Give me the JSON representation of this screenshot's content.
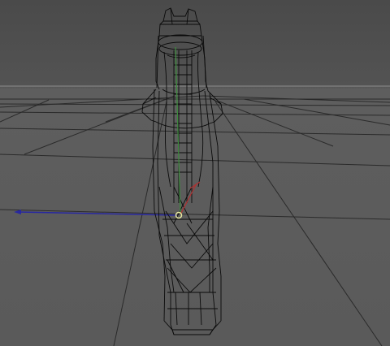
{
  "viewport": {
    "background_color": "#585858",
    "grid_color": "#2a2a2a",
    "horizon_color": "#8c8c8c",
    "wire_color": "#0a0a0a",
    "axis_x_color": "#b03030",
    "axis_y_color": "#3c8c3c",
    "axis_z_color": "#2828a0",
    "pivot_color": "#e8e8a0"
  },
  "object": {
    "type": "wireframe-mesh",
    "selected": false
  }
}
